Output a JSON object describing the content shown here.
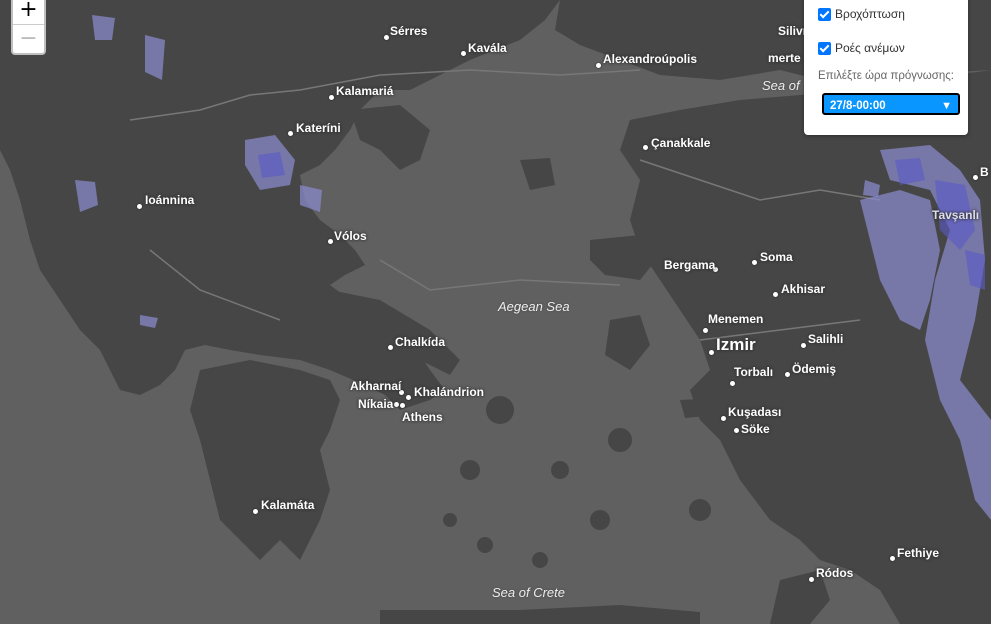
{
  "map": {
    "zoom_in": "+",
    "zoom_out": "−",
    "seas": {
      "aegean": "Aegean Sea",
      "crete": "Sea of Crete",
      "marmara_partial": "Sea of"
    },
    "cities": {
      "serres": "Sérres",
      "kavala": "Kavála",
      "alexandroupolis": "Alexandroúpolis",
      "kalamaria": "Kalamariá",
      "katerini": "Kateríni",
      "canakkale": "Çanakkale",
      "ioannina": "Ioánnina",
      "volos": "Vólos",
      "bergama": "Bergama",
      "soma": "Soma",
      "akhisar": "Akhisar",
      "menemen": "Menemen",
      "izmir": "Izmir",
      "salihli": "Salihli",
      "chalkida": "Chalkída",
      "torbali": "Torbalı",
      "odemis": "Ödemiş",
      "akharnai": "Akharnaí",
      "khalandrion": "Khalándrion",
      "nikaia": "Níkaia",
      "athens": "Athens",
      "kusadasi": "Kuşadası",
      "soke": "Söke",
      "kalamata": "Kalamáta",
      "fethiye": "Fethiye",
      "rodos": "Ródos",
      "tavsanli": "Tavşanlı",
      "silivri_partial": "Silivr",
      "tekirdag_partial": "merte",
      "bursa_partial": "B"
    }
  },
  "layers_panel": {
    "precipitation_label": "Βροχόπτωση",
    "precipitation_checked": true,
    "wind_label": "Ροές ανέμων",
    "wind_checked": true,
    "forecast_hint": "Επιλέξτε ώρα πρόγνωσης:",
    "forecast_selected": "27/8-00:00"
  },
  "colors": {
    "accent": "#0a96ff",
    "land": "#454545",
    "sea": "#606060",
    "rain": "#8c8cd2"
  }
}
